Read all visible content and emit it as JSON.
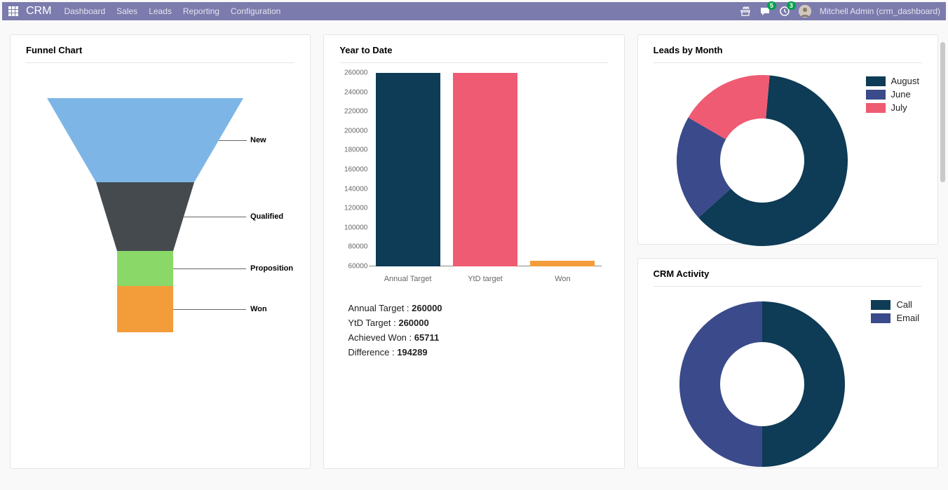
{
  "nav": {
    "brand": "CRM",
    "links": [
      "Dashboard",
      "Sales",
      "Leads",
      "Reporting",
      "Configuration"
    ],
    "msg_badge": "5",
    "act_badge": "3",
    "user": "Mitchell Admin (crm_dashboard)"
  },
  "colors": {
    "teal": "#0e3b55",
    "pink": "#ef5b72",
    "orange": "#f39c3a",
    "blue": "#7db6e6",
    "gray": "#454a4f",
    "green": "#8ad968",
    "slate": "#3a4a8a"
  },
  "funnel": {
    "title": "Funnel Chart",
    "stages": [
      {
        "label": "New",
        "color": "#7db6e6"
      },
      {
        "label": "Qualified",
        "color": "#454a4f"
      },
      {
        "label": "Proposition",
        "color": "#8ad968"
      },
      {
        "label": "Won",
        "color": "#f39c3a"
      }
    ]
  },
  "ytd": {
    "title": "Year to Date",
    "chart_data": {
      "type": "bar",
      "categories": [
        "Annual Target",
        "YtD target",
        "Won"
      ],
      "values": [
        260000,
        260000,
        65711
      ],
      "ylim": [
        60000,
        260000
      ],
      "yticks": [
        60000,
        80000,
        100000,
        120000,
        140000,
        160000,
        180000,
        200000,
        220000,
        240000,
        260000
      ],
      "colors": [
        "#0e3b55",
        "#ef5b72",
        "#f39c3a"
      ]
    },
    "stats": {
      "annual_label": "Annual Target : ",
      "annual_value": "260000",
      "ytd_label": "YtD Target : ",
      "ytd_value": "260000",
      "won_label": "Achieved Won : ",
      "won_value": "65711",
      "diff_label": "Difference : ",
      "diff_value": "194289"
    }
  },
  "leads": {
    "title": "Leads by Month",
    "chart_data": {
      "type": "pie",
      "series": [
        {
          "name": "August",
          "value": 62,
          "color": "#0e3b55"
        },
        {
          "name": "June",
          "value": 20,
          "color": "#3a4a8a"
        },
        {
          "name": "July",
          "value": 18,
          "color": "#ef5b72"
        }
      ]
    }
  },
  "activity": {
    "title": "CRM Activity",
    "chart_data": {
      "type": "pie",
      "series": [
        {
          "name": "Call",
          "value": 50,
          "color": "#0e3b55"
        },
        {
          "name": "Email",
          "value": 50,
          "color": "#3a4a8a"
        }
      ]
    }
  }
}
